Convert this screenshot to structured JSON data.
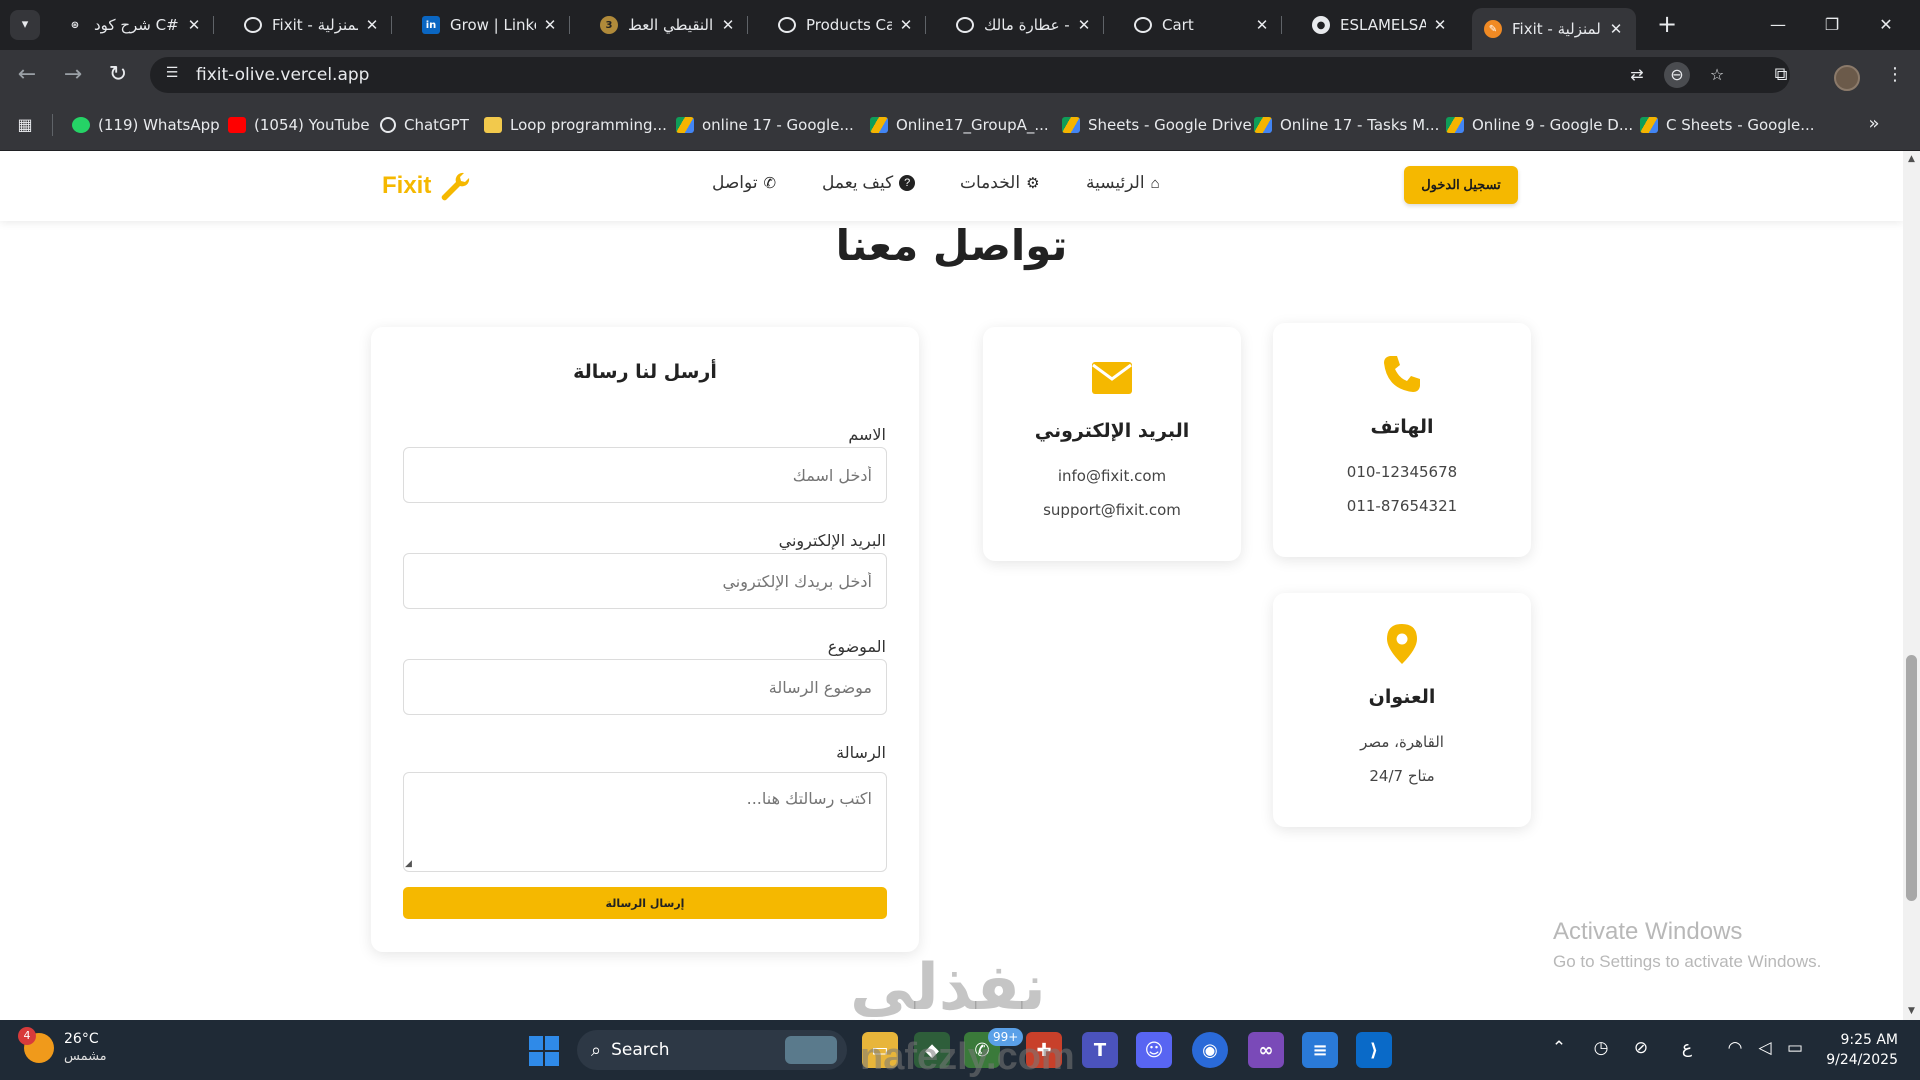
{
  "browser": {
    "tabs": [
      {
        "title": "شرح كود C#",
        "favicon_color": "#e8eaed"
      },
      {
        "title": "Fixit - المنزلية",
        "favicon_color": "#e8eaed"
      },
      {
        "title": "Grow | LinkedIn",
        "favicon_color": "#0a66c2"
      },
      {
        "title": "النقيطي العط",
        "favicon_color": "#b08a3a"
      },
      {
        "title": "Products Cat",
        "favicon_color": "#e8eaed"
      },
      {
        "title": "عطارة مالك -",
        "favicon_color": "#e8eaed"
      },
      {
        "title": "Cart",
        "favicon_color": "#e8eaed"
      },
      {
        "title": "ESLAMELSAA",
        "favicon_color": "#e8eaed"
      },
      {
        "title": "Fixit - المنزلية",
        "favicon_color": "#f08a24",
        "active": true
      }
    ],
    "url": "fixit-olive.vercel.app",
    "bookmarks": [
      {
        "label": "(119) WhatsApp",
        "color": "#25d366"
      },
      {
        "label": "(1054) YouTube",
        "color": "#ff0000"
      },
      {
        "label": "ChatGPT",
        "color": "#e8eaed"
      },
      {
        "label": "Loop programming...",
        "color": "#f2c94c"
      },
      {
        "label": "online 17 - Google...",
        "color": "#4285f4"
      },
      {
        "label": "Online17_GroupA_...",
        "color": "#4285f4"
      },
      {
        "label": "Sheets - Google Drive",
        "color": "#4285f4"
      },
      {
        "label": "Online 17 - Tasks M...",
        "color": "#4285f4"
      },
      {
        "label": "Online 9 - Google D...",
        "color": "#4285f4"
      },
      {
        "label": "C Sheets - Google...",
        "color": "#4285f4"
      }
    ]
  },
  "site": {
    "logo": "Fixit",
    "nav": {
      "home": "الرئيسية",
      "services": "الخدمات",
      "how": "كيف يعمل",
      "contact": "تواصل"
    },
    "login": "تسجيل الدخول",
    "accent": "#f5b800",
    "section_title": "تواصل معنا",
    "form": {
      "title": "أرسل لنا رسالة",
      "name_label": "الاسم",
      "name_placeholder": "أدخل اسمك",
      "email_label": "البريد الإلكتروني",
      "email_placeholder": "أدخل بريدك الإلكتروني",
      "subject_label": "الموضوع",
      "subject_placeholder": "موضوع الرسالة",
      "message_label": "الرسالة",
      "message_placeholder": "اكتب رسالتك هنا...",
      "submit": "إرسال الرسالة"
    },
    "phone": {
      "title": "الهاتف",
      "line1": "010-12345678",
      "line2": "011-87654321"
    },
    "email": {
      "title": "البريد الإلكتروني",
      "line1": "info@fixit.com",
      "line2": "support@fixit.com"
    },
    "address": {
      "title": "العنوان",
      "line1": "القاهرة، مصر",
      "line2": "متاح 24/7"
    }
  },
  "os": {
    "activate_title": "Activate Windows",
    "activate_sub": "Go to Settings to activate Windows.",
    "weather_temp": "26°C",
    "weather_desc": "مشمس",
    "weather_badge": "4",
    "search": "Search",
    "badge": "99+",
    "time": "9:25 AM",
    "date": "9/24/2025",
    "lang": "ع"
  },
  "watermark": {
    "arabic": "نفذلي",
    "url": "nafezly.com"
  }
}
